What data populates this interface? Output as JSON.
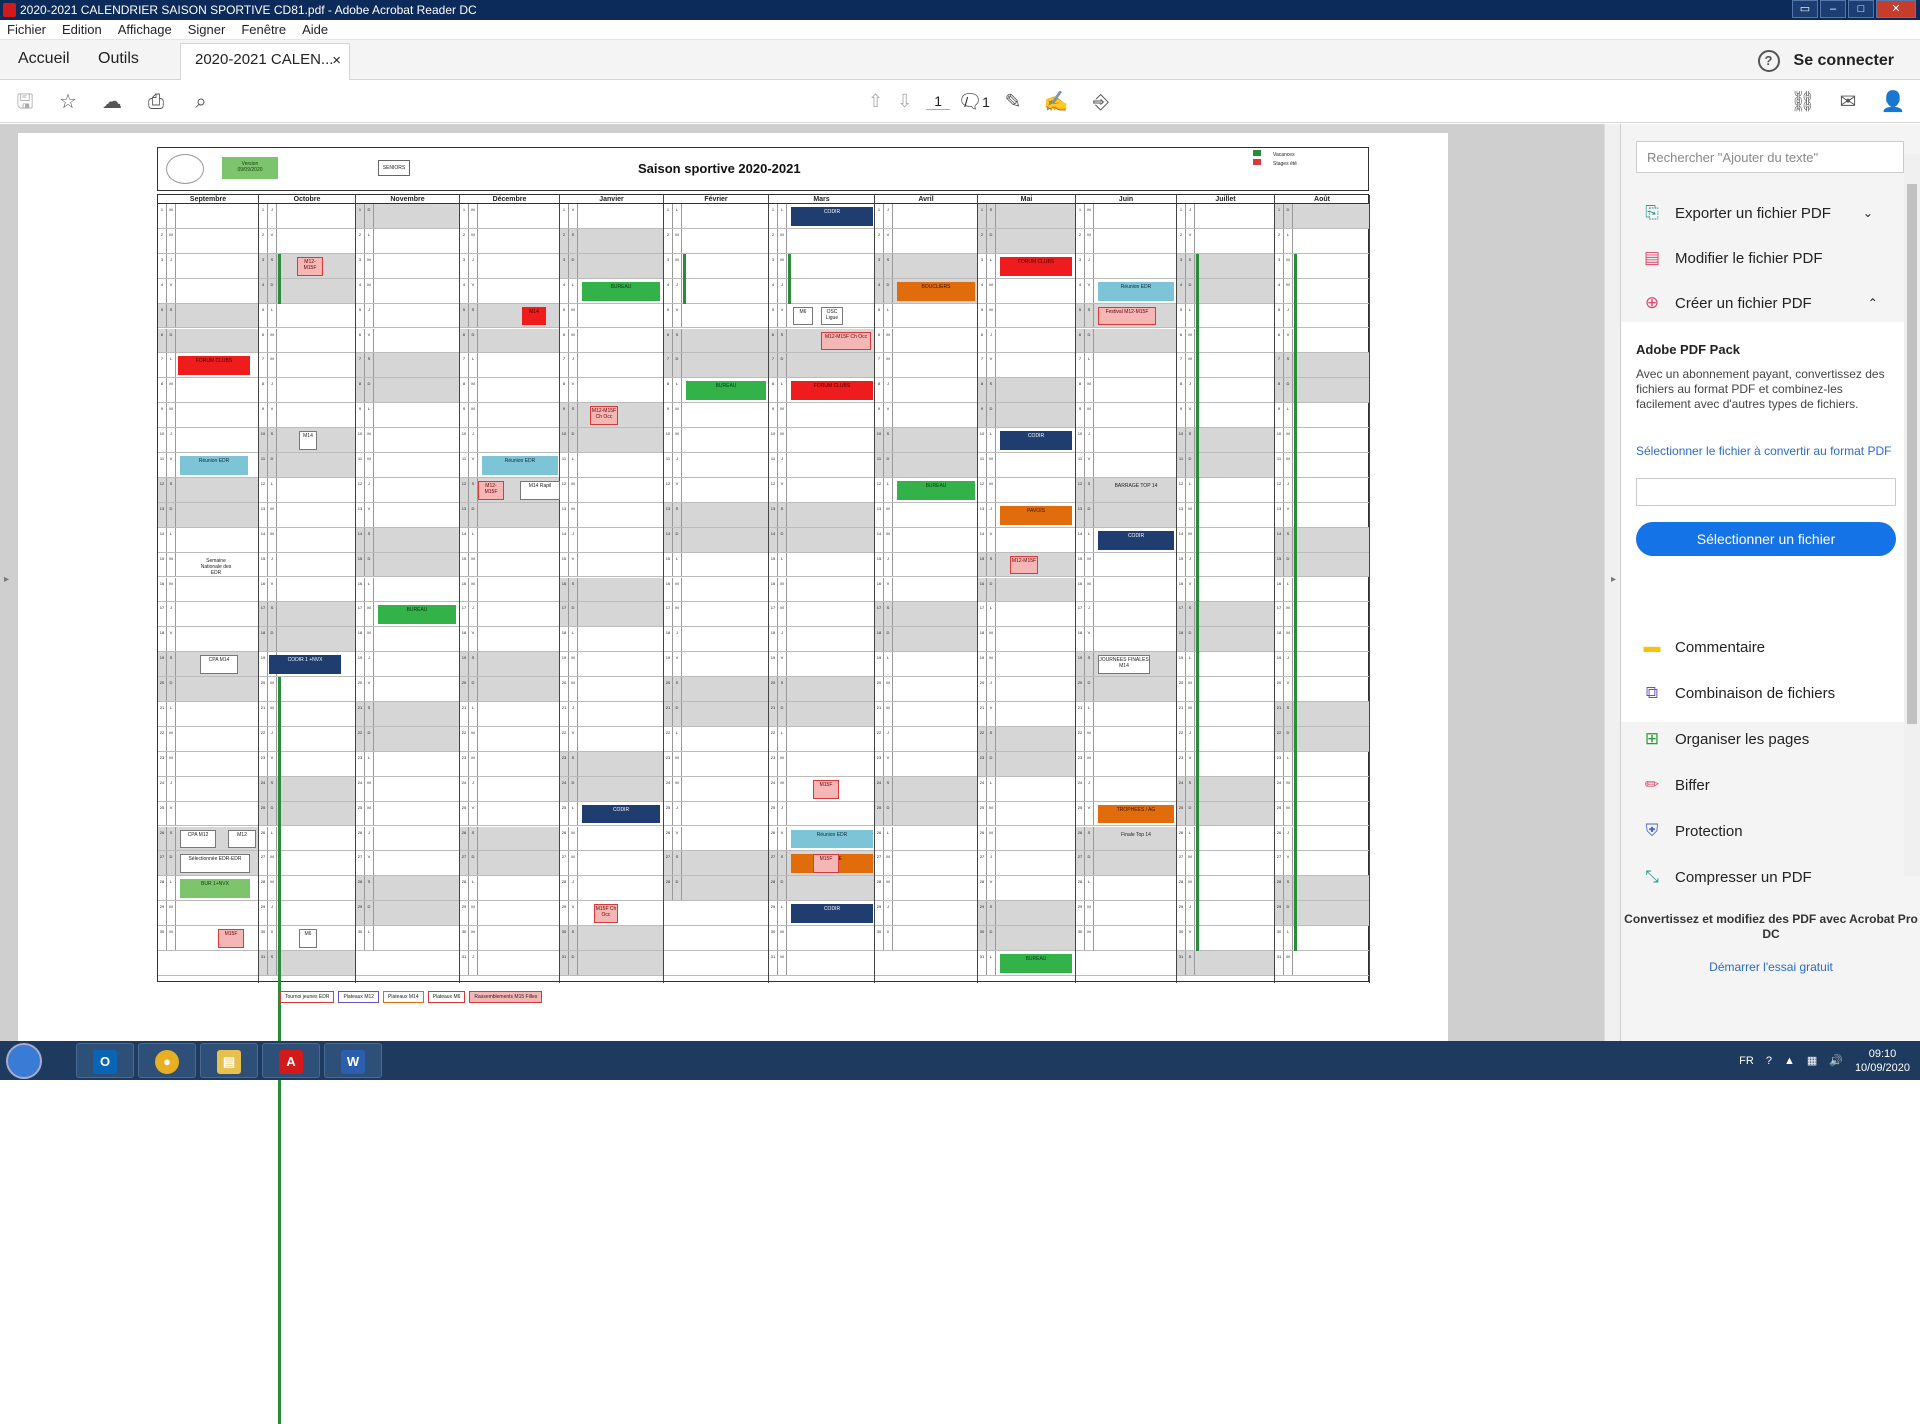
{
  "window": {
    "title": "2020-2021 CALENDRIER SAISON SPORTIVE CD81.pdf - Adobe Acrobat Reader DC"
  },
  "menu": [
    "Fichier",
    "Edition",
    "Affichage",
    "Signer",
    "Fenêtre",
    "Aide"
  ],
  "tabs": {
    "home": "Accueil",
    "tools": "Outils",
    "doc": "2020-2021 CALEN...",
    "close": "×",
    "signin": "Se connecter",
    "help": "?"
  },
  "toolbar": {
    "page_current": "1",
    "page_sep": "/",
    "page_total": "1"
  },
  "calendar": {
    "title": "Saison sportive 2020-2021",
    "version_line1": "Version",
    "version_line2": "09/09/2020",
    "seniors": "SENIORS",
    "legend": [
      "Vacances",
      "Stages été"
    ],
    "months": [
      "Septembre",
      "Octobre",
      "Novembre",
      "Décembre",
      "Janvier",
      "Février",
      "Mars",
      "Avril",
      "Mai",
      "Juin",
      "Juillet",
      "Août"
    ],
    "events": [
      {
        "text": "FORUM CLUBS",
        "color": "red"
      },
      {
        "text": "Réunion EDR",
        "color": "lblue"
      },
      {
        "text": "Semaine Nationale des EDR",
        "color": "plain"
      },
      {
        "text": "CPA M14",
        "color": "white"
      },
      {
        "text": "CPA M12",
        "color": "white"
      },
      {
        "text": "M12",
        "color": "white"
      },
      {
        "text": "Sélectionnée EDR-EDR",
        "color": "white"
      },
      {
        "text": "BUR 1+NVX",
        "color": "lgreen"
      },
      {
        "text": "M15F",
        "color": "pink"
      },
      {
        "text": "M12-M15F",
        "color": "pink"
      },
      {
        "text": "M14",
        "color": "white"
      },
      {
        "text": "M6",
        "color": "white"
      },
      {
        "text": "CODIR 1 +NVX",
        "color": "navy"
      },
      {
        "text": "BUREAU",
        "color": "green"
      },
      {
        "text": "CODIR",
        "color": "navy"
      },
      {
        "text": "M14",
        "color": "red"
      },
      {
        "text": "M12-M15F",
        "color": "pink"
      },
      {
        "text": "M14 Rapil",
        "color": "white"
      },
      {
        "text": "Réunion EDR",
        "color": "lblue"
      },
      {
        "text": "BUREAU",
        "color": "green"
      },
      {
        "text": "M12-M15F Ch Occ",
        "color": "pink"
      },
      {
        "text": "CODIR",
        "color": "navy"
      },
      {
        "text": "M15F Ch Occ",
        "color": "pink"
      },
      {
        "text": "BUREAU",
        "color": "green"
      },
      {
        "text": "CODIR",
        "color": "navy"
      },
      {
        "text": "FORUM CLUBS",
        "color": "red"
      },
      {
        "text": "M6",
        "color": "white"
      },
      {
        "text": "OSC Ligue",
        "color": "white"
      },
      {
        "text": "M12-M15F Ch Occ",
        "color": "pink"
      },
      {
        "text": "M15F",
        "color": "pink"
      },
      {
        "text": "Réunion EDR",
        "color": "lblue"
      },
      {
        "text": "P. ASTIE",
        "color": "orange"
      },
      {
        "text": "M15F",
        "color": "pink"
      },
      {
        "text": "CODIR",
        "color": "navy"
      },
      {
        "text": "BOUCLIERS",
        "color": "orange"
      },
      {
        "text": "BUREAU",
        "color": "green"
      },
      {
        "text": "FORUM CLUBS",
        "color": "red"
      },
      {
        "text": "CODIR",
        "color": "navy"
      },
      {
        "text": "PAVOIS",
        "color": "orange"
      },
      {
        "text": "M12-M15F",
        "color": "pink"
      },
      {
        "text": "BUREAU",
        "color": "green"
      },
      {
        "text": "Réunion EDR",
        "color": "lblue"
      },
      {
        "text": "Festival M12-M15F",
        "color": "pink"
      },
      {
        "text": "BARRAGE TOP 14",
        "color": "plain"
      },
      {
        "text": "CODIR",
        "color": "navy"
      },
      {
        "text": "JOURNEES FINALES M14",
        "color": "white"
      },
      {
        "text": "TROPHEES / AG",
        "color": "orange"
      },
      {
        "text": "Finale Top 14",
        "color": "plain"
      }
    ],
    "bottom_legend": [
      "Tournoi jeunes EDR",
      "Plateaux M12",
      "Plateaux M14",
      "Plateaux M6",
      "Rassemblements M15 Filles"
    ]
  },
  "right_panel": {
    "search_placeholder": "Rechercher \"Ajouter du texte\"",
    "tools_top": [
      {
        "label": "Exporter un fichier PDF",
        "icon": "export-pdf-icon",
        "color": "#2d9b8c"
      },
      {
        "label": "Modifier le fichier PDF",
        "icon": "edit-pdf-icon",
        "color": "#e0466b"
      },
      {
        "label": "Créer un fichier PDF",
        "icon": "create-pdf-icon",
        "color": "#e0466b"
      }
    ],
    "pack_title": "Adobe PDF Pack",
    "pack_desc": "Avec un abonnement payant, convertissez des fichiers au format PDF et combinez-les facilement avec d'autres types de fichiers.",
    "pack_link": "Sélectionner le fichier à convertir au format PDF",
    "pack_button": "Sélectionner un fichier",
    "tools_bottom": [
      {
        "label": "Commentaire",
        "icon": "comment-icon",
        "color": "#f5c400"
      },
      {
        "label": "Combinaison de fichiers",
        "icon": "combine-icon",
        "color": "#6b4fbb"
      },
      {
        "label": "Organiser les pages",
        "icon": "organize-icon",
        "color": "#2a9d3a"
      },
      {
        "label": "Biffer",
        "icon": "redact-icon",
        "color": "#e0466b"
      },
      {
        "label": "Protection",
        "icon": "shield-icon",
        "color": "#4a63c6"
      },
      {
        "label": "Compresser un PDF",
        "icon": "compress-icon",
        "color": "#2d9b8c"
      }
    ],
    "footer_text": "Convertissez et modifiez des PDF avec Acrobat Pro DC",
    "footer_link": "Démarrer l'essai gratuit"
  },
  "taskbar": {
    "lang": "FR",
    "time": "09:10",
    "date": "10/09/2020"
  }
}
